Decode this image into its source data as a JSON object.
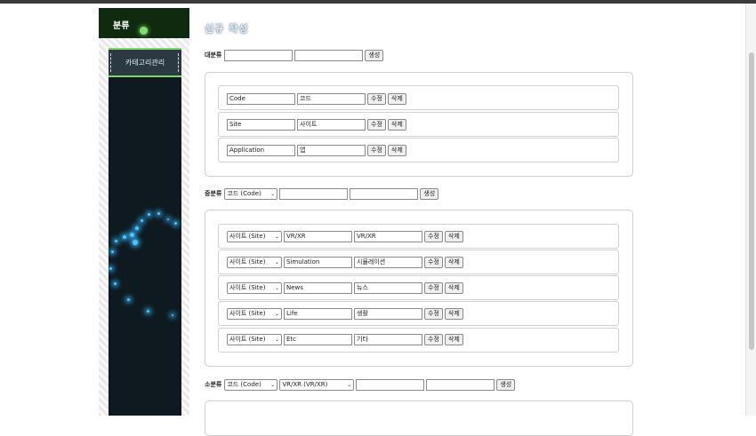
{
  "sidebar": {
    "title": "분류",
    "items": [
      {
        "label": "카테고리관리"
      }
    ]
  },
  "page": {
    "title": "신규 작성"
  },
  "major": {
    "label": "대분류",
    "create_label": "생성",
    "input1": "",
    "input2": "",
    "items": [
      {
        "code": "Code",
        "name": "코드",
        "edit": "수정",
        "delete": "삭제"
      },
      {
        "code": "Site",
        "name": "사이트",
        "edit": "수정",
        "delete": "삭제"
      },
      {
        "code": "Application",
        "name": "앱",
        "edit": "수정",
        "delete": "삭제"
      }
    ]
  },
  "middle": {
    "label": "중분류",
    "parent_select": "코드 (Code)",
    "create_label": "생성",
    "items": [
      {
        "parent": "사이트 (Site)",
        "code": "VR/XR",
        "name": "VR/XR",
        "edit": "수정",
        "delete": "삭제"
      },
      {
        "parent": "사이트 (Site)",
        "code": "Simulation",
        "name": "시뮬레이션",
        "edit": "수정",
        "delete": "삭제"
      },
      {
        "parent": "사이트 (Site)",
        "code": "News",
        "name": "뉴스",
        "edit": "수정",
        "delete": "삭제"
      },
      {
        "parent": "사이트 (Site)",
        "code": "Life",
        "name": "생활",
        "edit": "수정",
        "delete": "삭제"
      },
      {
        "parent": "사이트 (Site)",
        "code": "Etc",
        "name": "기타",
        "edit": "수정",
        "delete": "삭제"
      }
    ]
  },
  "minor": {
    "label": "소분류",
    "parent_select": "코드 (Code)",
    "middle_select": "VR/XR (VR/XR)",
    "create_label": "생성"
  },
  "icons": {
    "select_arrow": "chevron-down-icon"
  }
}
